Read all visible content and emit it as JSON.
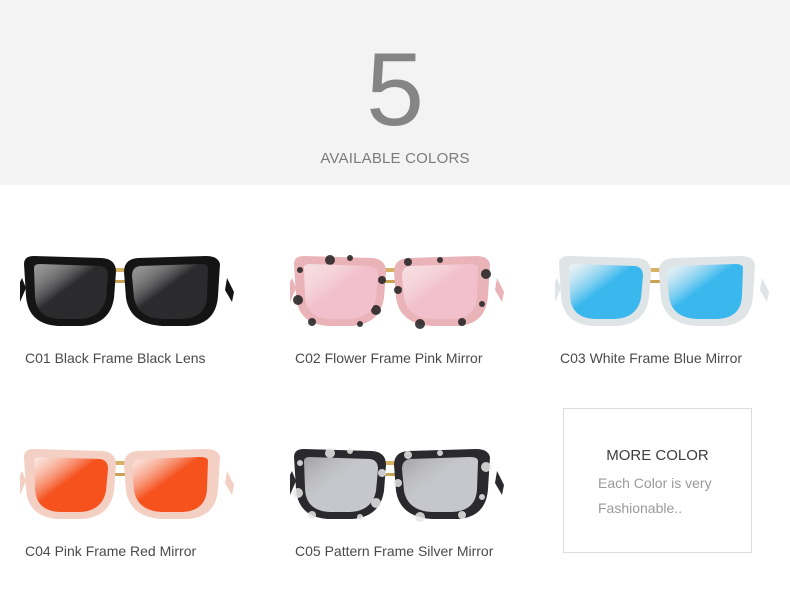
{
  "header": {
    "count": "5",
    "subtitle": "AVAILABLE COLORS"
  },
  "products": [
    {
      "caption": "C01 Black Frame Black Lens",
      "frame_color": "#141414",
      "lens_color": "#2b2b2e",
      "pattern": "solid"
    },
    {
      "caption": "C02 Flower Frame Pink Mirror",
      "frame_color": "#e9b3b8",
      "lens_color": "#f2c0cc",
      "pattern": "floral-black"
    },
    {
      "caption": "C03 White Frame Blue Mirror",
      "frame_color": "#dfe4e6",
      "lens_color": "#3ab8ee",
      "pattern": "solid"
    },
    {
      "caption": "C04 Pink Frame Red Mirror",
      "frame_color": "#f4cfc4",
      "lens_color": "#f5521e",
      "pattern": "solid"
    },
    {
      "caption": "C05 Pattern Frame Silver Mirror",
      "frame_color": "#2a2a2e",
      "lens_color": "#c6c7cc",
      "pattern": "floral-white"
    }
  ],
  "more": {
    "title": "MORE COLOR",
    "description": "Each Color is very Fashionable.."
  }
}
